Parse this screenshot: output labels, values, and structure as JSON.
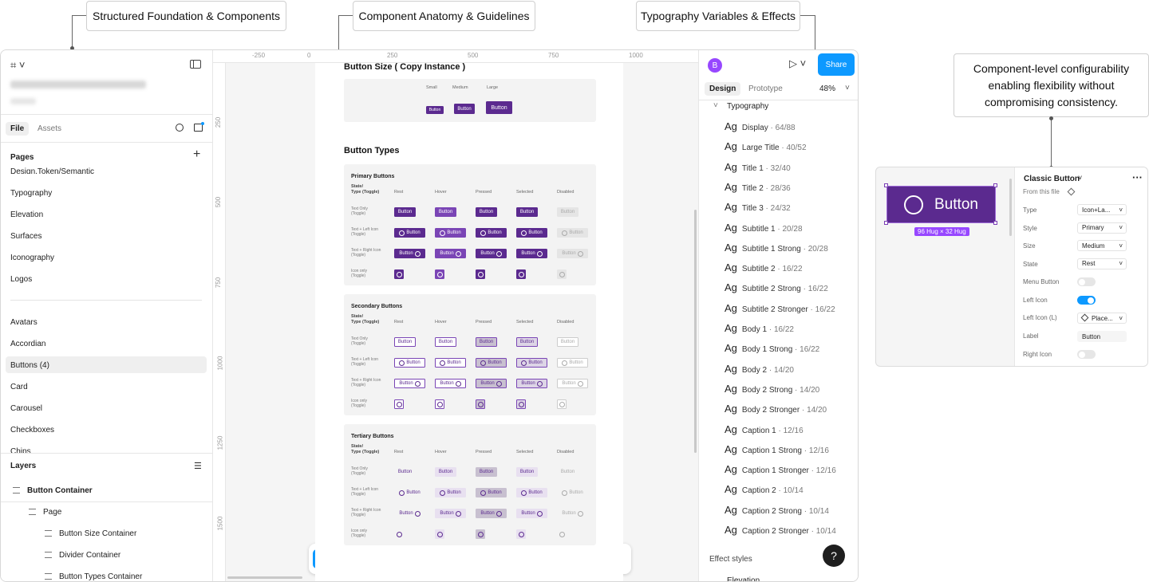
{
  "callouts": {
    "foundation": "Structured Foundation & Components",
    "anatomy": "Component Anatomy & Guidelines",
    "typography": "Typography Variables & Effects",
    "configurability": "Component-level configurability enabling flexibility without compromising consistency."
  },
  "left": {
    "file_tab": "File",
    "assets_tab": "Assets",
    "pages_title": "Pages",
    "pages": [
      "Design.Token/Semantic",
      "Typography",
      "Elevation",
      "Surfaces",
      "Iconography",
      "Logos"
    ],
    "pages2": [
      "Avatars",
      "Accordian",
      "Buttons (4)",
      "Card",
      "Carousel",
      "Checkboxes",
      "Chips"
    ],
    "layers_title": "Layers",
    "layers": [
      {
        "label": "Button Container"
      },
      {
        "label": "Page"
      },
      {
        "label": "Button Size Container"
      },
      {
        "label": "Divider Container"
      },
      {
        "label": "Button Types Container"
      }
    ]
  },
  "rulers": {
    "top": [
      "-250",
      "0",
      "250",
      "500",
      "750",
      "1000"
    ],
    "left": [
      "250",
      "500",
      "750",
      "1000",
      "1250",
      "1500"
    ]
  },
  "canvas": {
    "size_title": "Button Size ( Copy Instance )",
    "sizes": [
      "Small",
      "Medium",
      "Large"
    ],
    "button_label": "Button",
    "types_title": "Button Types",
    "groups": [
      "Primary Buttons",
      "Secondary Buttons",
      "Tertiary Buttons"
    ],
    "col_headers": [
      "State/\nType (Toggle)",
      "Rest",
      "Hover",
      "Pressed",
      "Selected",
      "Disabled"
    ],
    "row_labels": [
      "Text Only\n(Toggle)",
      "Text + Left Icon\n(Toggle)",
      "Text + Right Icon\n(Toggle)",
      "Icon only\n(Toggle)"
    ]
  },
  "right": {
    "avatar": "B",
    "share": "Share",
    "design_tab": "Design",
    "prototype_tab": "Prototype",
    "zoom": "48%",
    "section": "Typography",
    "styles": [
      {
        "name": "Display",
        "size": "64/88"
      },
      {
        "name": "Large Title",
        "size": "40/52"
      },
      {
        "name": "Title 1",
        "size": "32/40"
      },
      {
        "name": "Title 2",
        "size": "28/36"
      },
      {
        "name": "Title 3",
        "size": "24/32"
      },
      {
        "name": "Subtitle 1",
        "size": "20/28"
      },
      {
        "name": "Subtitle 1 Strong",
        "size": "20/28"
      },
      {
        "name": "Subtitle 2",
        "size": "16/22"
      },
      {
        "name": "Subtitle 2 Strong",
        "size": "16/22"
      },
      {
        "name": "Subtitle 2 Stronger",
        "size": "16/22"
      },
      {
        "name": "Body 1",
        "size": "16/22"
      },
      {
        "name": "Body 1 Strong",
        "size": "16/22"
      },
      {
        "name": "Body 2",
        "size": "14/20"
      },
      {
        "name": "Body 2 Strong",
        "size": "14/20"
      },
      {
        "name": "Body 2 Stronger",
        "size": "14/20"
      },
      {
        "name": "Caption 1",
        "size": "12/16"
      },
      {
        "name": "Caption 1 Strong",
        "size": "12/16"
      },
      {
        "name": "Caption 1 Stronger",
        "size": "12/16"
      },
      {
        "name": "Caption 2",
        "size": "10/14"
      },
      {
        "name": "Caption 2 Strong",
        "size": "10/14"
      },
      {
        "name": "Caption 2 Stronger",
        "size": "10/14"
      }
    ],
    "ag": "Ag",
    "effect_styles": "Effect styles",
    "elevation": "Elevation",
    "help": "?"
  },
  "component": {
    "button_label": "Button",
    "dim_badge": "96 Hug × 32 Hug",
    "title": "Classic Button",
    "from_file": "From this file",
    "props": [
      {
        "label": "Type",
        "value": "Icon+La..."
      },
      {
        "label": "Style",
        "value": "Primary"
      },
      {
        "label": "Size",
        "value": "Medium"
      },
      {
        "label": "State",
        "value": "Rest"
      }
    ],
    "menu_button": "Menu Button",
    "left_icon": "Left Icon",
    "left_icon_l": "Left Icon (L)",
    "left_icon_value": "Place...",
    "label": "Label",
    "label_value": "Button",
    "right_icon": "Right Icon",
    "toggles": {
      "menu_button": false,
      "left_icon": true,
      "right_icon": false
    }
  },
  "colors": {
    "primary": "#5b2a8f",
    "hover": "#7a45b5",
    "accent": "#0d99ff"
  }
}
